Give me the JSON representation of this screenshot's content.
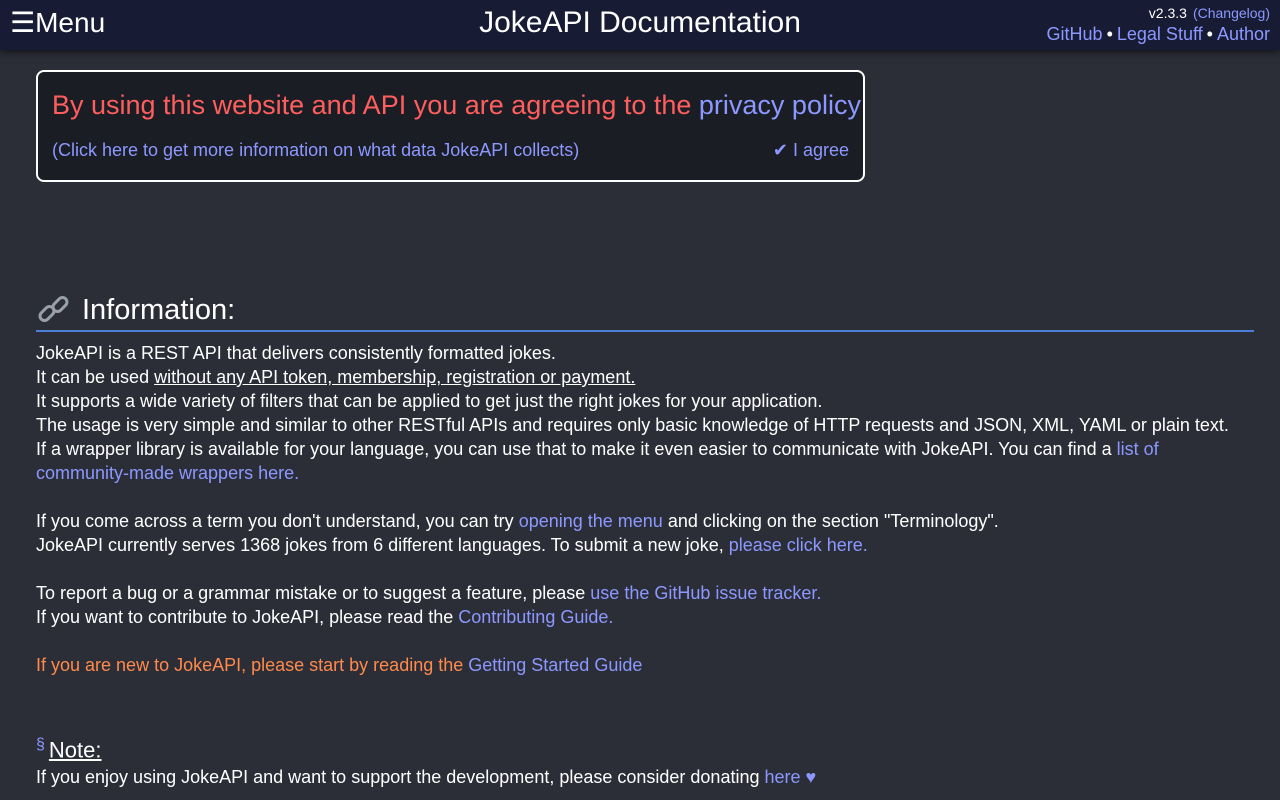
{
  "topbar": {
    "menu_icon": "☰",
    "menu_label": "Menu",
    "title": "JokeAPI Documentation",
    "version": "v2.3.3",
    "changelog": "(Changelog)",
    "links": [
      "GitHub",
      "Legal Stuff",
      "Author"
    ],
    "separator": "•"
  },
  "privacy": {
    "text_before": "By using this website and API you are agreeing to the ",
    "policy_link": "privacy policy",
    "info_link": "(Click here to get more information on what data JokeAPI collects)",
    "agree_icon": "✔",
    "agree_label": "I agree"
  },
  "information": {
    "icon": "link-icon",
    "title": "Information:",
    "line1": "JokeAPI is a REST API that delivers consistently formatted jokes.",
    "line2_before": "It can be used ",
    "line2_underlined": "without any API token, membership, registration or payment.",
    "line3": "It supports a wide variety of filters that can be applied to get just the right jokes for your application.",
    "line4": "The usage is very simple and similar to other RESTful APIs and requires only basic knowledge of HTTP requests and JSON, XML, YAML or plain text.",
    "line5_before": "If a wrapper library is available for your language, you can use that to make it even easier to communicate with JokeAPI. You can find a ",
    "line5_link": "list of community-made wrappers here.",
    "line6_before": "If you come across a term you don't understand, you can try ",
    "line6_link": "opening the menu",
    "line6_after": " and clicking on the section \"Terminology\".",
    "line7_before": "JokeAPI currently serves 1368 jokes from 6 different languages. To submit a new joke, ",
    "line7_link": "please click here.",
    "line8_before": "To report a bug or a grammar mistake or to suggest a feature, please ",
    "line8_link": "use the GitHub issue tracker.",
    "line9_before": "If you want to contribute to JokeAPI, please read the ",
    "line9_link": "Contributing Guide.",
    "line10_before": "If you are new to JokeAPI, please start by reading the ",
    "line10_link": "Getting Started Guide"
  },
  "note": {
    "section_symbol": "§",
    "title": "Note:",
    "text_before": "If you enjoy using JokeAPI and want to support the development, please consider donating ",
    "link": "here ♥"
  },
  "colors": {
    "background": "#2b2e37",
    "topbar": "#171b33",
    "link": "#8c98ff",
    "warning": "#ff5e5e",
    "highlight": "#ff8a4c",
    "divider": "#4a7fd6"
  }
}
